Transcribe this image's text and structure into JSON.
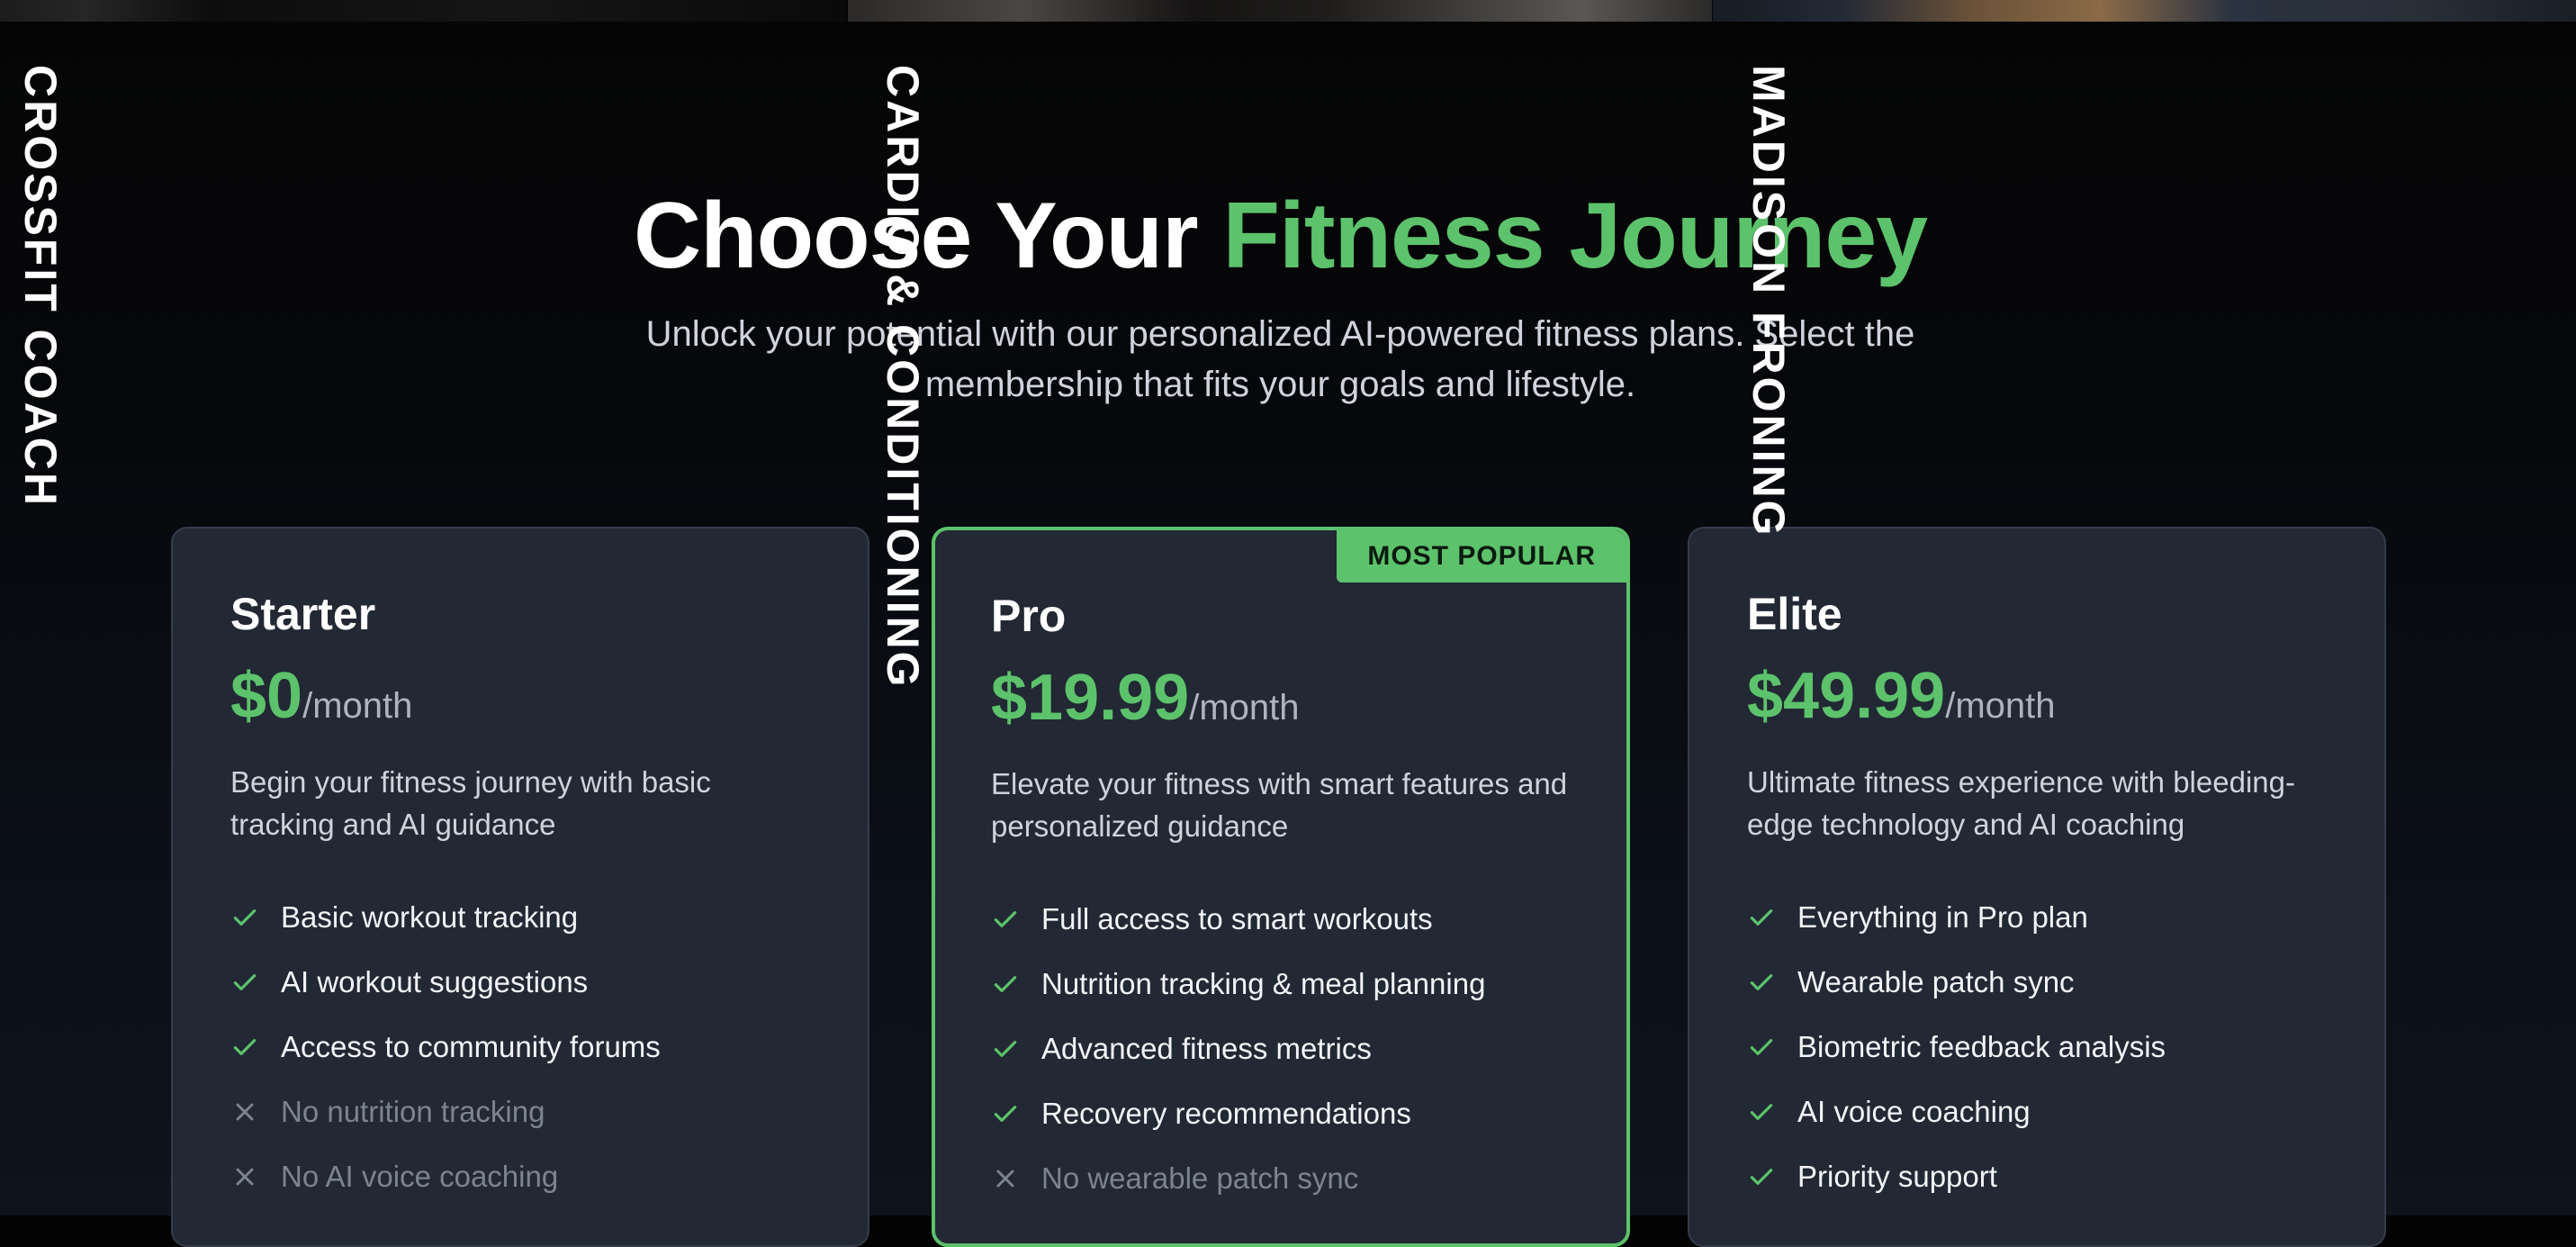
{
  "coaches": [
    "CROSSFIT COACH",
    "CARDIO & CONDITIONING",
    "MADISON FRONING"
  ],
  "hero": {
    "title_main": "Choose Your ",
    "title_accent": "Fitness Journey",
    "subtitle": "Unlock your potential with our personalized AI-powered fitness plans. Select the membership that fits your goals and lifestyle."
  },
  "colors": {
    "accent": "#5cc26b",
    "card_bg": "#222834",
    "page_bg": "#030303",
    "muted": "#7c8391"
  },
  "plans": [
    {
      "name": "Starter",
      "price": "$0",
      "period": "/month",
      "description": "Begin your fitness journey with basic tracking and AI guidance",
      "features": [
        {
          "text": "Basic workout tracking",
          "included": true,
          "icon": "check-icon"
        },
        {
          "text": "AI workout suggestions",
          "included": true,
          "icon": "check-icon"
        },
        {
          "text": "Access to community forums",
          "included": true,
          "icon": "check-icon"
        },
        {
          "text": "No nutrition tracking",
          "included": false,
          "icon": "x-icon"
        },
        {
          "text": "No AI voice coaching",
          "included": false,
          "icon": "x-icon"
        }
      ]
    },
    {
      "name": "Pro",
      "price": "$19.99",
      "period": "/month",
      "badge": "MOST POPULAR",
      "description": "Elevate your fitness with smart features and personalized guidance",
      "features": [
        {
          "text": "Full access to smart workouts",
          "included": true,
          "icon": "check-icon"
        },
        {
          "text": "Nutrition tracking & meal planning",
          "included": true,
          "icon": "check-icon"
        },
        {
          "text": "Advanced fitness metrics",
          "included": true,
          "icon": "check-icon"
        },
        {
          "text": "Recovery recommendations",
          "included": true,
          "icon": "check-icon"
        },
        {
          "text": "No wearable patch sync",
          "included": false,
          "icon": "x-icon"
        }
      ]
    },
    {
      "name": "Elite",
      "price": "$49.99",
      "period": "/month",
      "description": "Ultimate fitness experience with bleeding-edge technology and AI coaching",
      "features": [
        {
          "text": "Everything in Pro plan",
          "included": true,
          "icon": "check-icon"
        },
        {
          "text": "Wearable patch sync",
          "included": true,
          "icon": "check-icon"
        },
        {
          "text": "Biometric feedback analysis",
          "included": true,
          "icon": "check-icon"
        },
        {
          "text": "AI voice coaching",
          "included": true,
          "icon": "check-icon"
        },
        {
          "text": "Priority support",
          "included": true,
          "icon": "check-icon"
        }
      ]
    }
  ]
}
